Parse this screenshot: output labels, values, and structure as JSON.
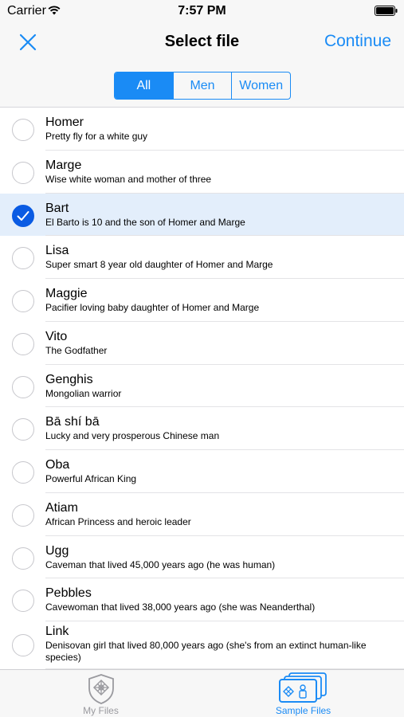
{
  "status": {
    "carrier": "Carrier",
    "time": "7:57 PM"
  },
  "nav": {
    "title": "Select file",
    "continue_label": "Continue",
    "close_icon": "close-icon"
  },
  "segments": [
    "All",
    "Men",
    "Women"
  ],
  "selected_segment": "All",
  "people": [
    {
      "name": "Homer",
      "desc": "Pretty fly for a white guy",
      "selected": false
    },
    {
      "name": "Marge",
      "desc": "Wise white woman and mother of three",
      "selected": false
    },
    {
      "name": "Bart",
      "desc": "El Barto is 10 and the son of Homer and Marge",
      "selected": true
    },
    {
      "name": "Lisa",
      "desc": "Super smart 8 year old daughter of Homer and Marge",
      "selected": false
    },
    {
      "name": "Maggie",
      "desc": "Pacifier loving baby daughter of Homer and Marge",
      "selected": false
    },
    {
      "name": "Vito",
      "desc": "The Godfather",
      "selected": false
    },
    {
      "name": "Genghis",
      "desc": "Mongolian warrior",
      "selected": false
    },
    {
      "name": "Bā shí bā",
      "desc": "Lucky and very prosperous Chinese man",
      "selected": false
    },
    {
      "name": "Oba",
      "desc": "Powerful African King",
      "selected": false
    },
    {
      "name": "Atiam",
      "desc": "African Princess and heroic leader",
      "selected": false
    },
    {
      "name": "Ugg",
      "desc": "Caveman that lived 45,000 years ago (he was human)",
      "selected": false
    },
    {
      "name": "Pebbles",
      "desc": "Cavewoman that lived 38,000 years ago (she was Neanderthal)",
      "selected": false
    },
    {
      "name": "Link",
      "desc": "Denisovan girl that lived 80,000 years ago (she's from an extinct human-like species)",
      "selected": false
    }
  ],
  "tabs": [
    {
      "label": "My Files",
      "icon": "shield-knot-icon",
      "active": false
    },
    {
      "label": "Sample Files",
      "icon": "stacked-cards-icon",
      "active": true
    }
  ],
  "colors": {
    "accent": "#1a8bf5",
    "selected_row": "#e3eefb",
    "check_selected": "#0a5be3"
  }
}
